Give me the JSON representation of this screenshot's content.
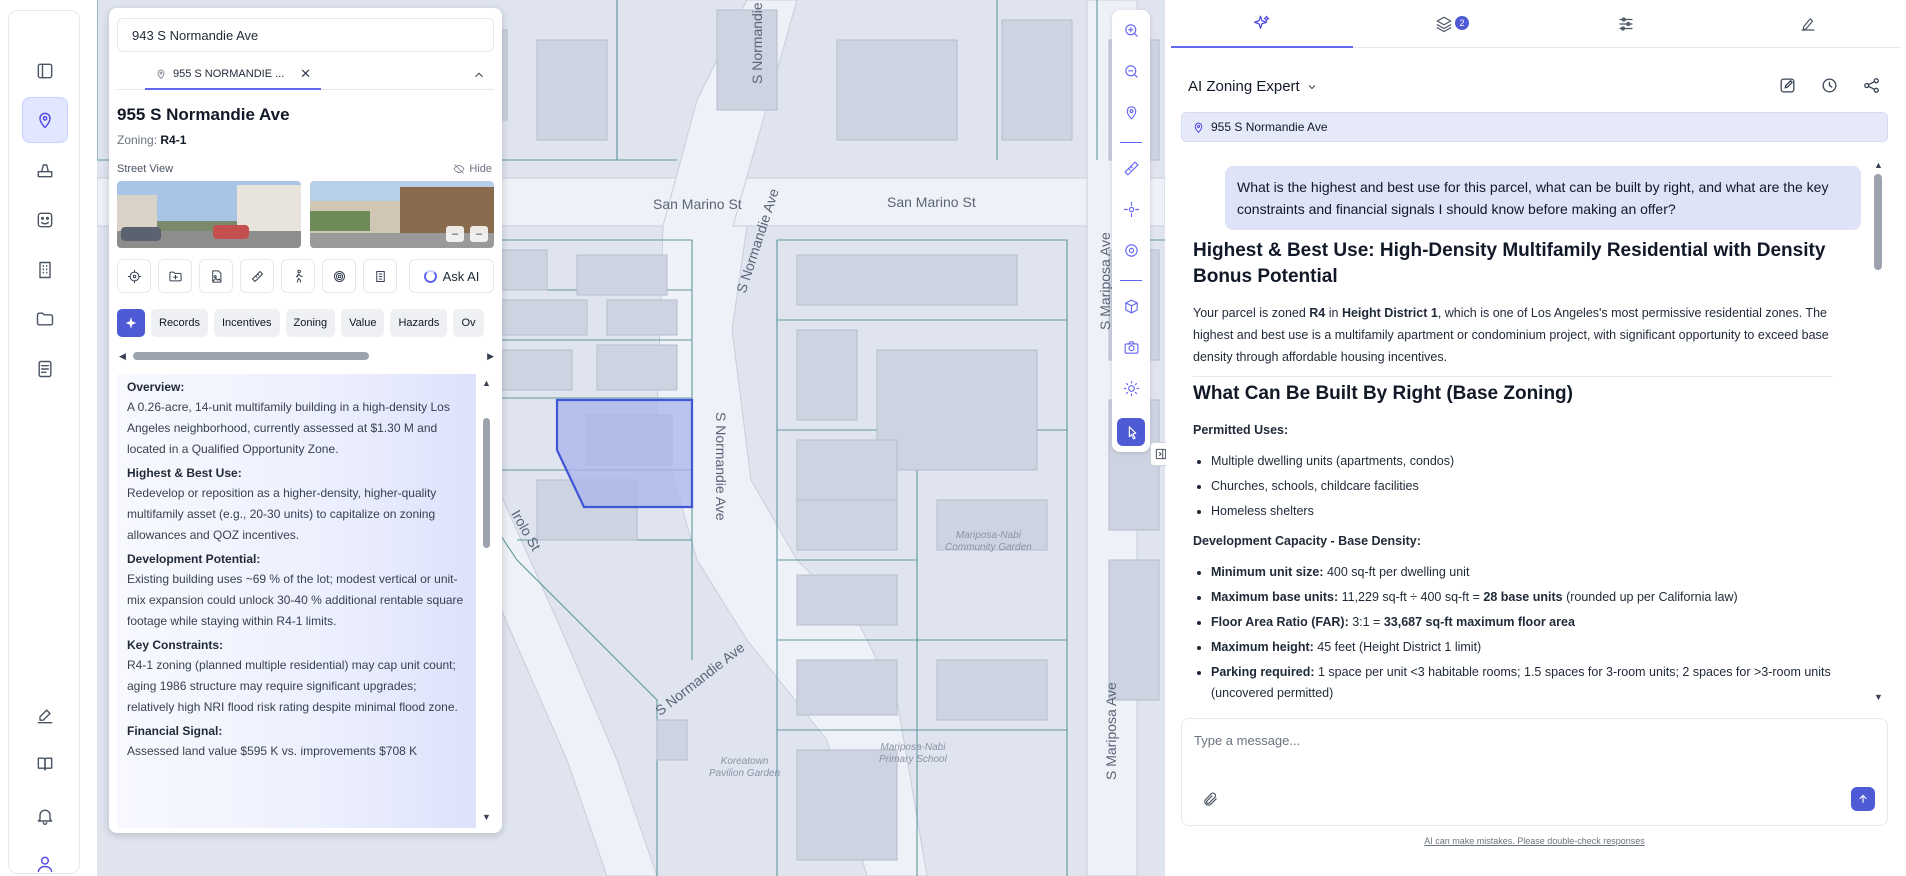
{
  "map": {
    "streets": [
      "San Marino St",
      "San Marino St",
      "S Normandie Ave",
      "S Normandie Ave",
      "S Normandie Ave",
      "S Normandie Ave",
      "S Mariposa Ave",
      "S Mariposa Ave",
      "Irolo St"
    ],
    "places": [
      "Mariposa-Nabi\nCommunity Garden",
      "Mariposa-Nabi\nPrimary School",
      "Koreatown\nPavilion Garden"
    ]
  },
  "panel": {
    "search_value": "943 S Normandie Ave",
    "tab_label": "955 S NORMANDIE ...",
    "title": "955 S Normandie Ave",
    "zoning_label": "Zoning:",
    "zoning_value": "R4-1",
    "street_view_label": "Street View",
    "hide_label": "Hide",
    "ask_ai_label": "Ask AI",
    "categories": [
      "Records",
      "Incentives",
      "Zoning",
      "Value",
      "Hazards",
      "Ov"
    ],
    "summary": [
      {
        "heading": "Overview:",
        "text": "A 0.26-acre, 14-unit multifamily building in a high-density Los Angeles neighborhood, currently assessed at $1.30 M and located in a Qualified Opportunity Zone."
      },
      {
        "heading": "Highest & Best Use:",
        "text": "Redevelop or reposition as a higher-density, higher-quality multifamily asset (e.g., 20-30 units) to capitalize on zoning allowances and QOZ incentives."
      },
      {
        "heading": "Development Potential:",
        "text": "Existing building uses ~69 % of the lot; modest vertical or unit-mix expansion could unlock 30-40 % additional rentable square footage while staying within R4-1 limits."
      },
      {
        "heading": "Key Constraints:",
        "text": "R4-1 zoning (planned multiple residential) may cap unit count; aging 1986 structure may require significant upgrades; relatively high NRI flood risk rating despite minimal flood zone."
      },
      {
        "heading": "Financial Signal:",
        "text": "Assessed land value $595 K vs. improvements $708 K"
      }
    ]
  },
  "chat": {
    "agent_name": "AI Zoning Expert",
    "layers_badge": "2",
    "address": "955 S Normandie Ave",
    "user_message": "What is the highest and best use for this parcel, what can be built by right, and what are the key constraints and financial signals I should know before making an offer?",
    "h1_prefix": "Highest & Best Use: ",
    "h1_main": "High-Density Multifamily Residential with Density Bonus Potential",
    "intro": {
      "p1": "Your parcel is zoned ",
      "zone": "R4",
      "p2": " in ",
      "district": "Height District 1",
      "p3": ", which is one of Los Angeles's most permissive residential zones. The highest and best use is a multifamily apartment or condominium project, with significant opportunity to exceed base density through affordable housing incentives."
    },
    "h2": "What Can Be Built By Right (Base Zoning)",
    "permitted_label": "Permitted Uses:",
    "permitted": [
      "Multiple dwelling units (apartments, condos)",
      "Churches, schools, childcare facilities",
      "Homeless shelters"
    ],
    "capacity_label": "Development Capacity - Base Density:",
    "capacity": [
      {
        "k": "Minimum unit size:",
        "v": " 400 sq-ft per dwelling unit",
        "b": "",
        "t": ""
      },
      {
        "k": "Maximum base units:",
        "v": " 11,229 sq-ft ÷ 400 sq-ft = ",
        "b": "28 base units",
        "t": " (rounded up per California law)"
      },
      {
        "k": "Floor Area Ratio (FAR):",
        "v": " 3:1 = ",
        "b": "33,687 sq-ft maximum floor area",
        "t": ""
      },
      {
        "k": "Maximum height:",
        "v": " 45 feet (Height District 1 limit)",
        "b": "",
        "t": ""
      },
      {
        "k": "Parking required:",
        "v": " 1 space per unit <3 habitable rooms; 1.5 spaces for 3-room units; 2 spaces for >3-room units (uncovered permitted)",
        "b": "",
        "t": ""
      }
    ],
    "input_placeholder": "Type a message...",
    "disclaimer": "AI can make mistakes. Please double-check responses"
  }
}
